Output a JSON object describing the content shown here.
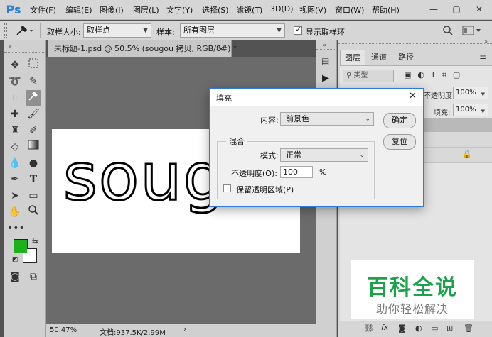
{
  "app": {
    "logo": "Ps"
  },
  "menu": [
    "文件(F)",
    "编辑(E)",
    "图像(I)",
    "图层(L)",
    "文字(Y)",
    "选择(S)",
    "滤镜(T)",
    "3D(D)",
    "视图(V)",
    "窗口(W)",
    "帮助(H)"
  ],
  "window_controls": {
    "minimize": "—",
    "restore": "▢",
    "close": "✕"
  },
  "options": {
    "sample_size_label": "取样大小:",
    "sample_size_value": "取样点",
    "sample_label": "样本:",
    "sample_value": "所有图层",
    "show_ring_label": "显示取样环",
    "show_ring_checked": true
  },
  "document": {
    "tab_title": "未标题-1.psd @ 50.5% (sougou 拷贝, RGB/8#) *",
    "canvas_text": "soug",
    "zoom": "50.47%",
    "doc_info": "文档:937.5K/2.99M"
  },
  "colors": {
    "foreground": "#1db21d",
    "background": "#ffffff",
    "dialog_border": "#2d7ad8",
    "watermark_green": "#1aa34a"
  },
  "panel": {
    "tabs": [
      "图层",
      "通道",
      "路径"
    ],
    "filter_label": "类型",
    "opacity_label": "不透明度:",
    "opacity_value": "100%",
    "fill_label": "填充:",
    "fill_value": "100%"
  },
  "dialog": {
    "title": "填充",
    "content_label": "内容:",
    "content_value": "前景色",
    "ok_label": "确定",
    "reset_label": "复位",
    "blend_group_label": "混合",
    "mode_label": "模式:",
    "mode_value": "正常",
    "opacity_label": "不透明度(O):",
    "opacity_value": "100",
    "opacity_unit": "%",
    "preserve_label": "保留透明区域(P)",
    "preserve_checked": false
  },
  "watermark": {
    "title": "百科全说",
    "subtitle": "助你轻松解决"
  }
}
